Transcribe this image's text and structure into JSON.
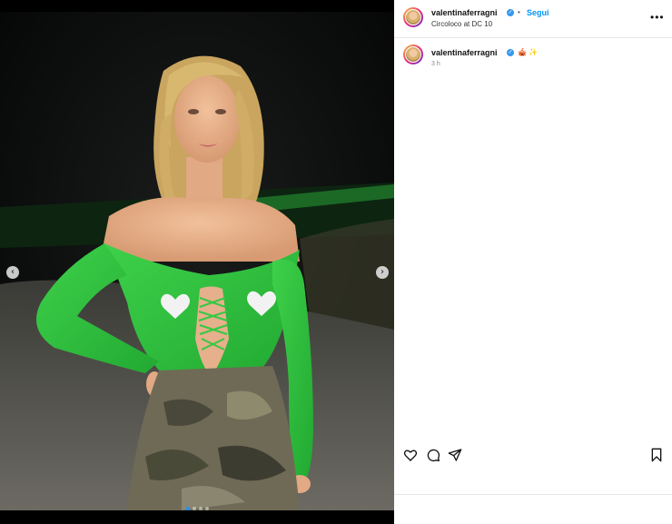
{
  "post": {
    "username": "valentinaferragni",
    "follow_label": "Segui",
    "separator": "•",
    "location": "Circoloco at DC 10",
    "caption_emojis": "🎪 ✨",
    "time_ago": "3 h",
    "more_label": "•••"
  },
  "media": {
    "prev_label": "‹",
    "next_label": "›",
    "carousel_count": 4,
    "carousel_active": 1,
    "accent_dot_color": "#1e90ff"
  },
  "icons": {
    "heart": "heart-icon",
    "comment": "comment-icon",
    "share": "share-icon",
    "save": "bookmark-icon",
    "verified": "verified-badge-icon"
  },
  "colors": {
    "follow": "#0095f6",
    "verified": "#3897f0"
  }
}
